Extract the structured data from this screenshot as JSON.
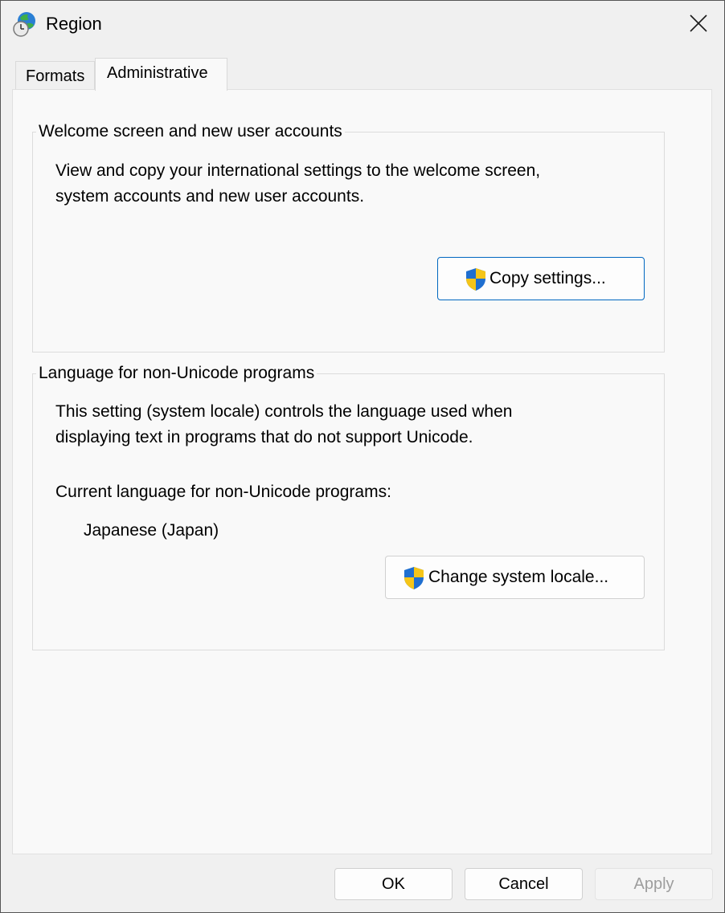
{
  "window": {
    "title": "Region",
    "icon": "globe-clock-icon",
    "close_icon": "close-icon"
  },
  "tabs": [
    {
      "label": "Formats",
      "active": false
    },
    {
      "label": "Administrative",
      "active": true
    }
  ],
  "welcome_group": {
    "title": "Welcome screen and new user accounts",
    "description_line1": "View and copy your international settings to the welcome screen,",
    "description_line2": "system accounts and new user accounts.",
    "button_label": "Copy settings...",
    "button_icon": "uac-shield-icon"
  },
  "locale_group": {
    "title": "Language for non-Unicode programs",
    "description_line1": "This setting (system locale) controls the language used when",
    "description_line2": "displaying text in programs that do not support Unicode.",
    "current_label": "Current language for non-Unicode programs:",
    "current_value": "Japanese (Japan)",
    "button_label": "Change system locale...",
    "button_icon": "uac-shield-icon"
  },
  "footer": {
    "ok": "OK",
    "cancel": "Cancel",
    "apply": "Apply",
    "apply_enabled": false
  },
  "colors": {
    "accent": "#0067c0",
    "shield_blue": "#1f6fd0",
    "shield_yellow": "#f5c518"
  }
}
